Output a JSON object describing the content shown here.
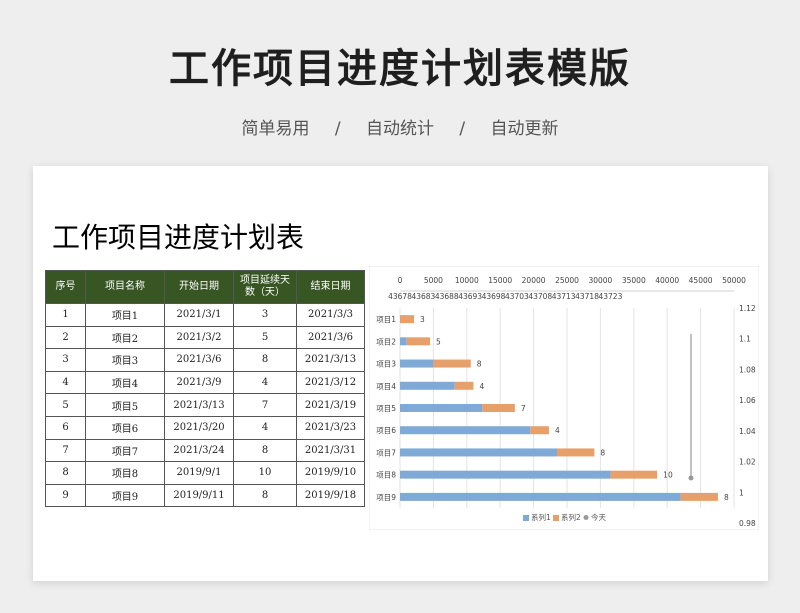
{
  "banner": {
    "title": "工作项目进度计划表模版",
    "features": [
      "简单易用",
      "/",
      "自动统计",
      "/",
      "自动更新"
    ]
  },
  "sheet": {
    "title": "工作项目进度计划表",
    "headers": [
      "序号",
      "项目名称",
      "开始日期",
      "项目延续天数（天）",
      "结束日期"
    ],
    "rows": [
      [
        "1",
        "项目1",
        "2021/3/1",
        "3",
        "2021/3/3"
      ],
      [
        "2",
        "项目2",
        "2021/3/2",
        "5",
        "2021/3/6"
      ],
      [
        "3",
        "项目3",
        "2021/3/6",
        "8",
        "2021/3/13"
      ],
      [
        "4",
        "项目4",
        "2021/3/9",
        "4",
        "2021/3/12"
      ],
      [
        "5",
        "项目5",
        "2021/3/13",
        "7",
        "2021/3/19"
      ],
      [
        "6",
        "项目6",
        "2021/3/20",
        "4",
        "2021/3/23"
      ],
      [
        "7",
        "项目7",
        "2021/3/24",
        "8",
        "2021/3/31"
      ],
      [
        "8",
        "项目8",
        "2019/9/1",
        "10",
        "2019/9/10"
      ],
      [
        "9",
        "项目9",
        "2019/9/11",
        "8",
        "2019/9/18"
      ]
    ]
  },
  "chart_data": {
    "type": "bar",
    "orientation": "horizontal-stacked",
    "categories": [
      "项目1",
      "项目2",
      "项目3",
      "项目4",
      "项目5",
      "项目6",
      "项目7",
      "项目8",
      "项目9"
    ],
    "series": [
      {
        "name": "系列1",
        "color": "#7fa9d6",
        "values": [
          0,
          1000,
          5000,
          8200,
          12300,
          19500,
          23500,
          31500,
          42000
        ]
      },
      {
        "name": "系列2",
        "color": "#e8a06b",
        "values": [
          3,
          5,
          8,
          4,
          7,
          4,
          8,
          10,
          8
        ]
      },
      {
        "name": "今天",
        "color": "#999999",
        "type": "marker"
      }
    ],
    "data_labels": [
      "3",
      "5",
      "8",
      "4",
      "7",
      "4",
      "8",
      "10",
      "8"
    ],
    "x_top_ticks": [
      "0",
      "5000",
      "10000",
      "15000",
      "20000",
      "25000",
      "30000",
      "35000",
      "40000",
      "45000",
      "50000"
    ],
    "x_date_ticks": [
      "43678",
      "43683",
      "43688",
      "43693",
      "43698",
      "43703",
      "43708",
      "43713",
      "43718",
      "43723"
    ],
    "y2_ticks": [
      "1.12",
      "1.1",
      "1.08",
      "1.06",
      "1.04",
      "1.02",
      "1",
      "0.98"
    ],
    "xlim": [
      0,
      50000
    ],
    "grid": true,
    "legend": "bottom"
  }
}
